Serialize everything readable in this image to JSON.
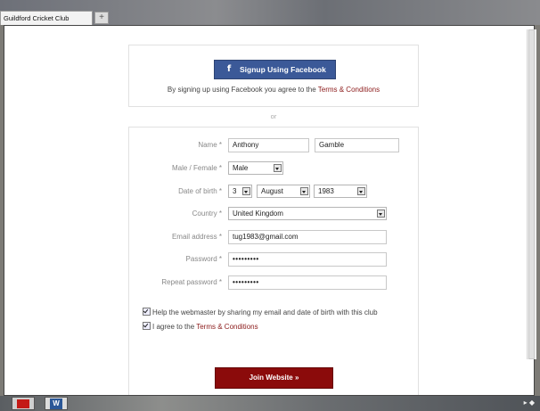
{
  "browser": {
    "tab_title": "Guildford Cricket Club",
    "new_tab": "+"
  },
  "facebook": {
    "button_label": "Signup Using Facebook",
    "icon_glyph": "f",
    "note_prefix": "By signing up using Facebook you agree to the",
    "note_link": "Terms & Conditions"
  },
  "separator": "or",
  "form": {
    "name_label": "Name *",
    "first_name": "Anthony",
    "last_name": "Gamble",
    "gender_label": "Male / Female *",
    "gender_value": "Male",
    "dob_label": "Date of birth *",
    "dob_day": "3",
    "dob_month": "August",
    "dob_year": "1983",
    "country_label": "Country *",
    "country_value": "United Kingdom",
    "email_label": "Email address *",
    "email_value": "tug1983@gmail.com",
    "password_label": "Password *",
    "password_value": "•••••••••",
    "repeat_label": "Repeat password *",
    "repeat_value": "•••••••••",
    "help_checkbox": "Help the webmaster by sharing my email and date of birth with this club",
    "terms_prefix": "I agree to the",
    "terms_link": "Terms & Conditions",
    "join_button": "Join Website »"
  },
  "taskbar": {
    "word_glyph": "W",
    "tray_text": "▸ ◆"
  },
  "colors": {
    "facebook_blue": "#3b5998",
    "join_red": "#8b0b0b",
    "link_red": "#8b1a1a"
  }
}
